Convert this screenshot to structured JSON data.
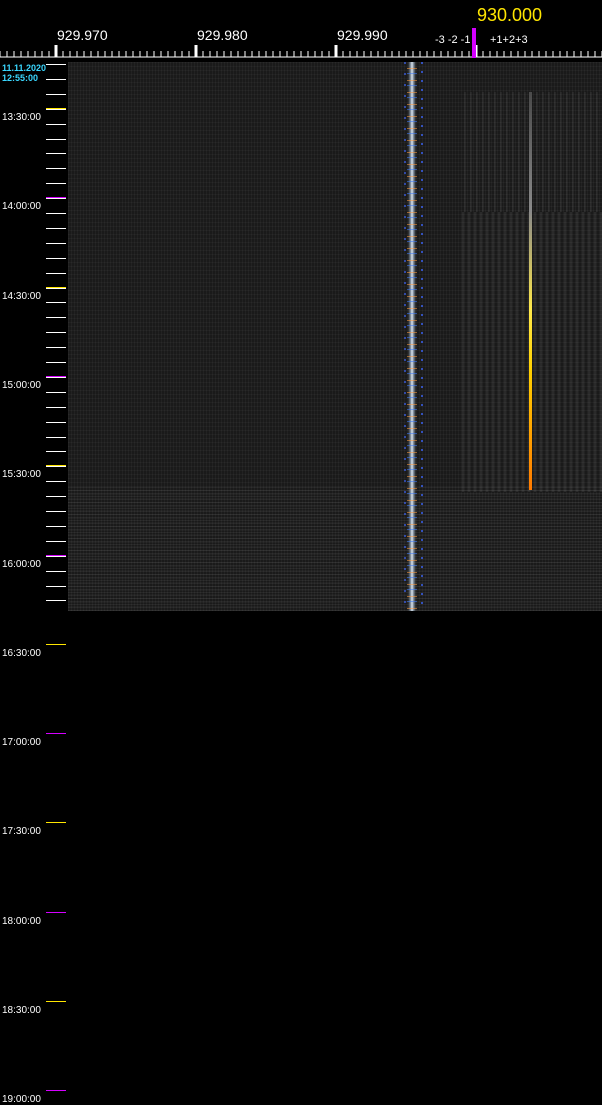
{
  "header": {
    "freq_labels": [
      "929.970",
      "929.980",
      "929.990"
    ],
    "center_freq": "930.000",
    "neg_offsets": "-3 -2 -1",
    "pos_offsets": "+1+2+3"
  },
  "timeline": {
    "date": "11.11.2020",
    "start_time": "12:55:00",
    "times": [
      "13:30:00",
      "14:00:00",
      "14:30:00",
      "15:00:00",
      "15:30:00",
      "16:00:00",
      "16:30:00",
      "17:00:00",
      "17:30:00",
      "18:00:00",
      "18:30:00",
      "19:00:00"
    ]
  },
  "colors": {
    "center_marker": "#d400ff",
    "center_freq_text": "#ffe600",
    "date_text": "#3ad7ff",
    "tick_yellow": "#ffe600",
    "tick_magenta": "#d400ff"
  }
}
